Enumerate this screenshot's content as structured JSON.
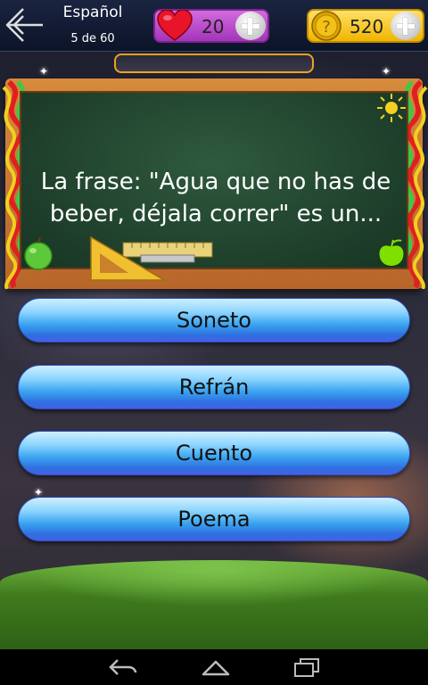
{
  "header": {
    "topic": "Español",
    "progress": "5 de 60",
    "lives": "20",
    "coins": "520"
  },
  "question": {
    "text": "La frase: \"Agua que no has de beber, déjala correr\" es un..."
  },
  "answers": [
    {
      "label": "Soneto"
    },
    {
      "label": "Refrán"
    },
    {
      "label": "Cuento"
    },
    {
      "label": "Poema"
    }
  ],
  "colors": {
    "lives_pill": "#a235b8",
    "coins_pill": "#f0b500",
    "answer_button": "#3aa4f0",
    "board_frame": "#b8662a",
    "chalkboard": "#1e3f2b"
  },
  "icons": {
    "back": "back-arrow-icon",
    "heart": "heart-icon",
    "coin": "question-coin-icon",
    "plus": "plus-icon",
    "nav_back": "nav-back-icon",
    "nav_home": "nav-home-icon",
    "nav_recent": "nav-recent-apps-icon"
  }
}
